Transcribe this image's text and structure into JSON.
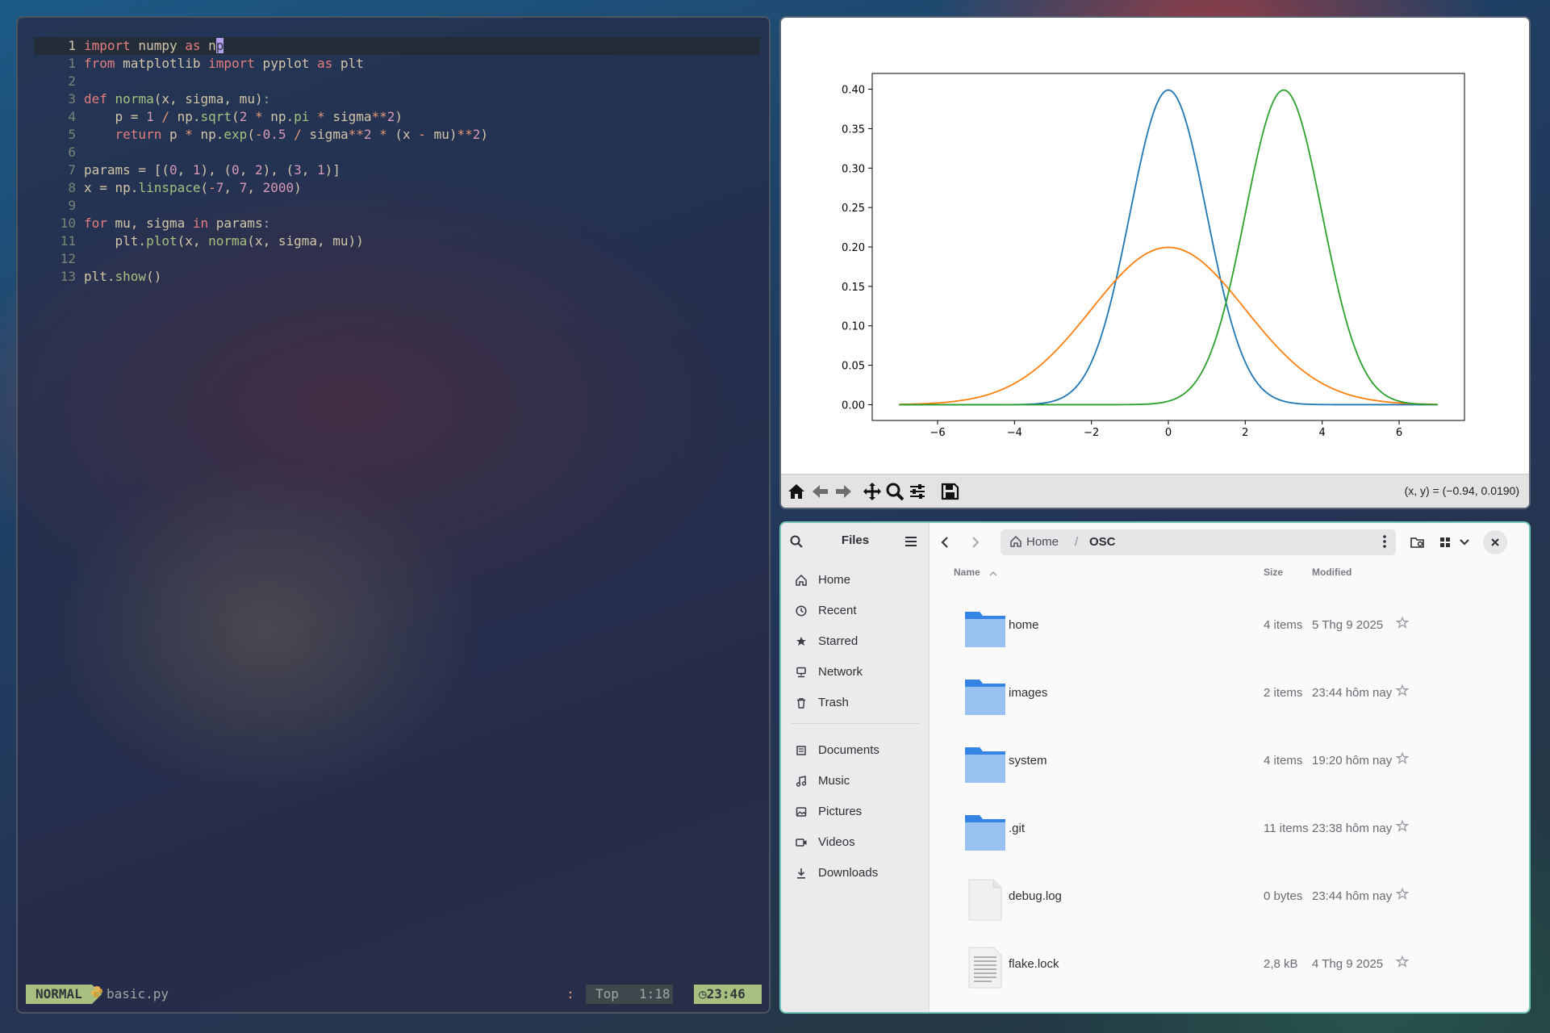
{
  "editor": {
    "lines": [
      {
        "n": "1",
        "current": true,
        "html": "<span class=\"kw\">import</span> numpy <span class=\"kw\">as</span> n<span class=\"cursor\">p</span>"
      },
      {
        "n": "1",
        "html": "<span class=\"kw\">from</span> matplotlib <span class=\"kw\">import</span> pyplot <span class=\"kw\">as</span> plt"
      },
      {
        "n": "2",
        "html": ""
      },
      {
        "n": "3",
        "html": "<span class=\"kw\">def</span> <span class=\"fn\">norma</span>(x, sigma, mu)<span class=\"dim\">:</span>"
      },
      {
        "n": "4",
        "html": "    p = <span class=\"num\">1</span> <span class=\"op\">/</span> np.<span class=\"fn\">sqrt</span>(<span class=\"num\">2</span> <span class=\"op\">*</span> np.<span class=\"fn\">pi</span> <span class=\"op\">*</span> sigma<span class=\"op\">**</span><span class=\"num\">2</span>)"
      },
      {
        "n": "5",
        "html": "    <span class=\"kw\">return</span> p <span class=\"op\">*</span> np.<span class=\"fn\">exp</span>(<span class=\"op\">-</span><span class=\"num\">0.5</span> <span class=\"op\">/</span> sigma<span class=\"op\">**</span><span class=\"num\">2</span> <span class=\"op\">*</span> (x <span class=\"op\">-</span> mu)<span class=\"op\">**</span><span class=\"num\">2</span>)"
      },
      {
        "n": "6",
        "html": ""
      },
      {
        "n": "7",
        "html": "params = [(<span class=\"num\">0</span>, <span class=\"num\">1</span>), (<span class=\"num\">0</span>, <span class=\"num\">2</span>), (<span class=\"num\">3</span>, <span class=\"num\">1</span>)]"
      },
      {
        "n": "8",
        "html": "x = np.<span class=\"fn\">linspace</span>(<span class=\"op\">-</span><span class=\"num\">7</span>, <span class=\"num\">7</span>, <span class=\"num\">2000</span>)"
      },
      {
        "n": "9",
        "html": ""
      },
      {
        "n": "10",
        "html": "<span class=\"kw\">for</span> mu, sigma <span class=\"kw\">in</span> params<span class=\"dim\">:</span>"
      },
      {
        "n": "11",
        "html": "    plt.<span class=\"fn\">plot</span>(x, <span class=\"fn\">norma</span>(x, sigma, mu))"
      },
      {
        "n": "12",
        "html": ""
      },
      {
        "n": "13",
        "html": "plt.<span class=\"fn\">show</span>()"
      }
    ],
    "status": {
      "mode": "NORMAL",
      "file": "basic.py",
      "colon": ":",
      "scroll": "Top",
      "position": "1:18",
      "time": "23:46"
    }
  },
  "plot": {
    "coord_text": "(x, y) = (−0.94, 0.0190)",
    "toolbar": [
      "home-icon",
      "back-arrow-icon",
      "forward-arrow-icon",
      "pan-icon",
      "zoom-icon",
      "configure-icon",
      "save-icon"
    ]
  },
  "chart_data": {
    "type": "line",
    "x_range": [
      -7,
      7
    ],
    "xlim": [
      -7.7,
      7.7
    ],
    "ylim": [
      -0.02,
      0.42
    ],
    "x_ticks": [
      -6,
      -4,
      -2,
      0,
      2,
      4,
      6
    ],
    "x_tick_labels": [
      "−6",
      "−4",
      "−2",
      "0",
      "2",
      "4",
      "6"
    ],
    "y_ticks": [
      0.0,
      0.05,
      0.1,
      0.15,
      0.2,
      0.25,
      0.3,
      0.35,
      0.4
    ],
    "y_tick_labels": [
      "0.00",
      "0.05",
      "0.10",
      "0.15",
      "0.20",
      "0.25",
      "0.30",
      "0.35",
      "0.40"
    ],
    "grid": false,
    "series": [
      {
        "distribution": "normal",
        "mu": 0,
        "sigma": 1,
        "color": "#1f77b4",
        "peak": 0.399
      },
      {
        "distribution": "normal",
        "mu": 0,
        "sigma": 2,
        "color": "#ff7f0e",
        "peak": 0.199
      },
      {
        "distribution": "normal",
        "mu": 3,
        "sigma": 1,
        "color": "#2ca02c",
        "peak": 0.399
      }
    ]
  },
  "files": {
    "title": "Files",
    "sidebar": [
      {
        "label": "Home",
        "icon": "home-icon"
      },
      {
        "label": "Recent",
        "icon": "clock-icon"
      },
      {
        "label": "Starred",
        "icon": "star-icon"
      },
      {
        "label": "Network",
        "icon": "network-icon"
      },
      {
        "label": "Trash",
        "icon": "trash-icon"
      },
      {
        "label": "Documents",
        "icon": "document-icon"
      },
      {
        "label": "Music",
        "icon": "music-icon"
      },
      {
        "label": "Pictures",
        "icon": "picture-icon"
      },
      {
        "label": "Videos",
        "icon": "video-icon"
      },
      {
        "label": "Downloads",
        "icon": "download-icon"
      }
    ],
    "path": {
      "home": "Home",
      "separator": "/",
      "current": "OSC"
    },
    "headers": {
      "name": "Name",
      "size": "Size",
      "modified": "Modified"
    },
    "rows": [
      {
        "name": "home",
        "type": "folder",
        "size": "4 items",
        "modified": "5 Thg 9 2025"
      },
      {
        "name": "images",
        "type": "folder",
        "size": "2 items",
        "modified": "23:44 hôm nay"
      },
      {
        "name": "system",
        "type": "folder",
        "size": "4 items",
        "modified": "19:20 hôm nay"
      },
      {
        "name": ".git",
        "type": "folder",
        "size": "11 items",
        "modified": "23:38 hôm nay"
      },
      {
        "name": "debug.log",
        "type": "file",
        "size": "0 bytes",
        "modified": "23:44 hôm nay"
      },
      {
        "name": "flake.lock",
        "type": "text-file",
        "size": "2,8 kB",
        "modified": "4 Thg 9 2025"
      }
    ]
  }
}
